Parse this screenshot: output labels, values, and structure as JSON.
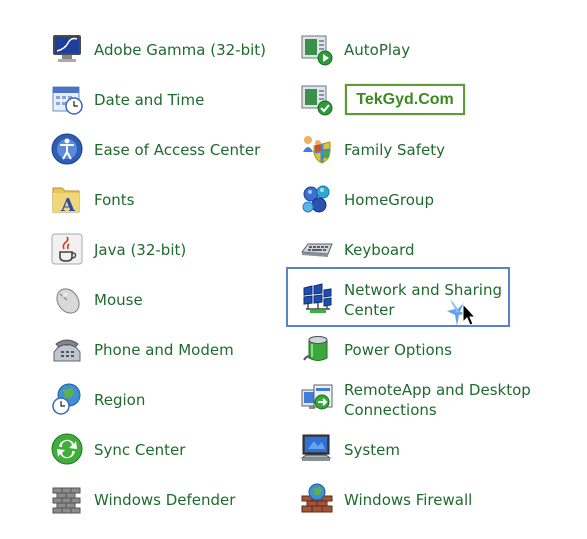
{
  "left_column": [
    {
      "label": "Adobe Gamma (32-bit)",
      "icon": "monitor-gamma-icon"
    },
    {
      "label": "Date and Time",
      "icon": "calendar-clock-icon"
    },
    {
      "label": "Ease of Access Center",
      "icon": "ease-of-access-icon"
    },
    {
      "label": "Fonts",
      "icon": "fonts-folder-icon"
    },
    {
      "label": "Java (32-bit)",
      "icon": "java-icon"
    },
    {
      "label": "Mouse",
      "icon": "mouse-icon"
    },
    {
      "label": "Phone and Modem",
      "icon": "phone-icon"
    },
    {
      "label": "Region",
      "icon": "globe-clock-icon"
    },
    {
      "label": "Sync Center",
      "icon": "sync-icon"
    },
    {
      "label": "Windows Defender",
      "icon": "defender-wall-icon"
    }
  ],
  "right_column": [
    {
      "label": "AutoPlay",
      "icon": "autoplay-icon"
    },
    {
      "label": "",
      "icon": "default-programs-icon"
    },
    {
      "label": "Family Safety",
      "icon": "family-safety-icon"
    },
    {
      "label": "HomeGroup",
      "icon": "homegroup-icon"
    },
    {
      "label": "Keyboard",
      "icon": "keyboard-icon"
    },
    {
      "label_line1": "Network and Sharing",
      "label_line2": "Center",
      "icon": "network-icon"
    },
    {
      "label": "Power Options",
      "icon": "battery-icon"
    },
    {
      "label_line1": "RemoteApp and Desktop",
      "label_line2": "Connections",
      "icon": "remoteapp-icon"
    },
    {
      "label": "System",
      "icon": "system-computer-icon"
    },
    {
      "label": "Windows Firewall",
      "icon": "firewall-icon"
    }
  ],
  "watermark": {
    "text": "TekGyd.Com"
  },
  "colors": {
    "label": "#1e6b2e",
    "highlight_border": "#5b82c4",
    "watermark_border": "#5f9a36",
    "watermark_text": "#3c8a1f"
  }
}
